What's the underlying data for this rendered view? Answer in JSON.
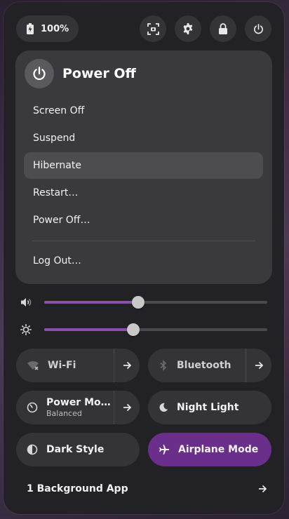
{
  "battery": {
    "label": "100%"
  },
  "top_buttons": [
    "screenshot-icon",
    "settings-icon",
    "lock-icon",
    "power-icon"
  ],
  "power_menu": {
    "title": "Power Off",
    "items": [
      {
        "label": "Screen Off"
      },
      {
        "label": "Suspend"
      },
      {
        "label": "Hibernate",
        "highlighted": true
      },
      {
        "label": "Restart…"
      },
      {
        "label": "Power Off…"
      },
      {
        "label": "Log Out…"
      }
    ]
  },
  "sliders": {
    "volume": {
      "icon": "speaker-icon",
      "value": 0.42
    },
    "brightness": {
      "icon": "brightness-icon",
      "value": 0.4
    }
  },
  "toggles": {
    "wifi": {
      "label": "Wi-Fi"
    },
    "bluetooth": {
      "label": "Bluetooth"
    },
    "power_mode": {
      "label": "Power Mo…",
      "subtitle": "Balanced"
    },
    "night_light": {
      "label": "Night Light"
    },
    "dark_style": {
      "label": "Dark Style"
    },
    "airplane_mode": {
      "label": "Airplane Mode",
      "active": true
    }
  },
  "background_apps": {
    "label": "1 Background App"
  },
  "colors": {
    "accent": "#6a2f8a",
    "slider_fill": "#8a4fa6",
    "panel": "#222226"
  }
}
